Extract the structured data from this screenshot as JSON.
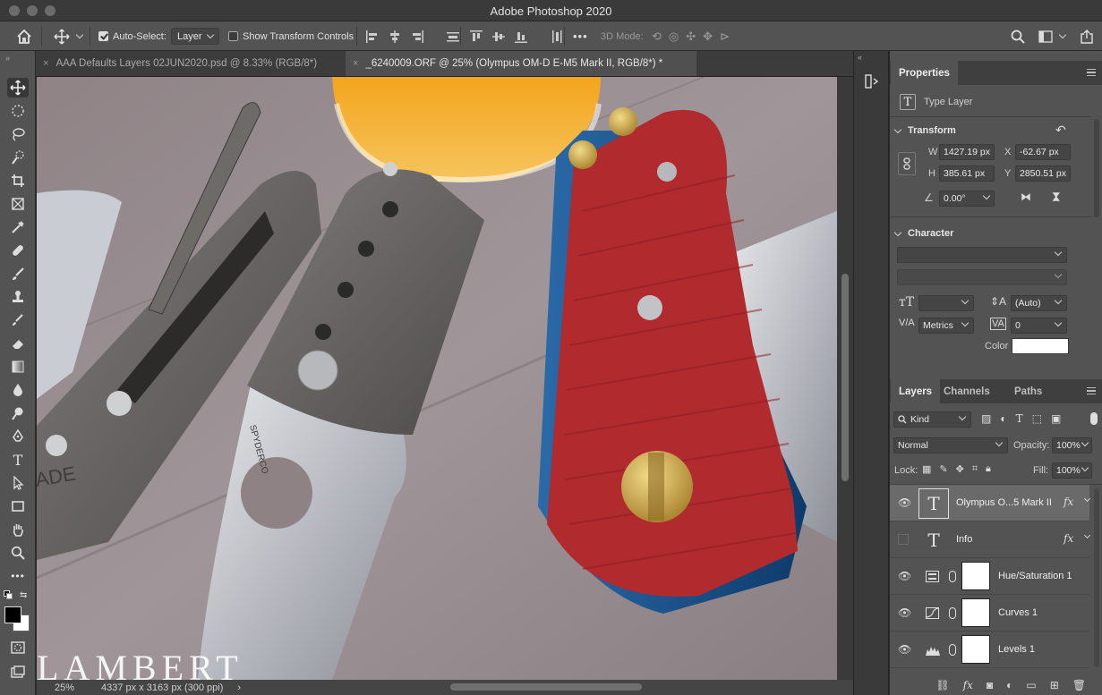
{
  "app": {
    "title": "Adobe Photoshop 2020"
  },
  "options_bar": {
    "auto_select_label": "Auto-Select:",
    "auto_select_value": "Layer",
    "show_transform_label": "Show Transform Controls",
    "mode_3d_label": "3D Mode:",
    "more_label": "•••"
  },
  "tabs": [
    {
      "label": "AAA Defaults Layers 02JUN2020.psd @ 8.33% (RGB/8*)",
      "close": "×"
    },
    {
      "label": "_6240009.ORF @ 25% (Olympus OM-D E-M5 Mark II, RGB/8*) *",
      "close": "×"
    }
  ],
  "status": {
    "zoom": "25%",
    "doc_info": "4337 px x 3163 px (300 ppi)",
    "arrow": "›"
  },
  "watermark": "LAMBERT",
  "canvas_text": {
    "spyderco": "SPYDERCO",
    "made": "ADE"
  },
  "properties": {
    "tab": "Properties",
    "type_label": "Type Layer",
    "transform_title": "Transform",
    "w_label": "W",
    "w_value": "1427.19 px",
    "x_label": "X",
    "x_value": "-62.67 px",
    "h_label": "H",
    "h_value": "385.61 px",
    "y_label": "Y",
    "y_value": "2850.51 px",
    "angle_value": "0.00°",
    "character_title": "Character",
    "leading_value": "(Auto)",
    "kerning_value": "Metrics",
    "tracking_value": "0",
    "color_label": "Color",
    "color_swatch": "#ffffff"
  },
  "layers_panel": {
    "tabs": [
      "Layers",
      "Channels",
      "Paths"
    ],
    "kind_label": "Kind",
    "blend_mode": "Normal",
    "opacity_label": "Opacity:",
    "opacity_value": "100%",
    "lock_label": "Lock:",
    "fill_label": "Fill:",
    "fill_value": "100%",
    "layers": [
      {
        "name": "Olympus O...5 Mark II",
        "type": "text",
        "visible": true,
        "selected": true,
        "fx": "fx"
      },
      {
        "name": "Info",
        "type": "text",
        "visible": false,
        "selected": false,
        "fx": "fx"
      },
      {
        "name": "Hue/Saturation 1",
        "type": "adjustment",
        "visible": true,
        "selected": false,
        "fx": ""
      },
      {
        "name": "Curves 1",
        "type": "adjustment",
        "visible": true,
        "selected": false,
        "fx": ""
      },
      {
        "name": "Levels 1",
        "type": "adjustment",
        "visible": true,
        "selected": false,
        "fx": ""
      }
    ],
    "footer_fx": "fx"
  },
  "colors": {
    "panel_bg": "#535353",
    "tab_bg": "#3c3c3c",
    "selected_layer": "#6a6a6a",
    "knife_red": "#b02a2e",
    "brass": "#c9a23e"
  }
}
